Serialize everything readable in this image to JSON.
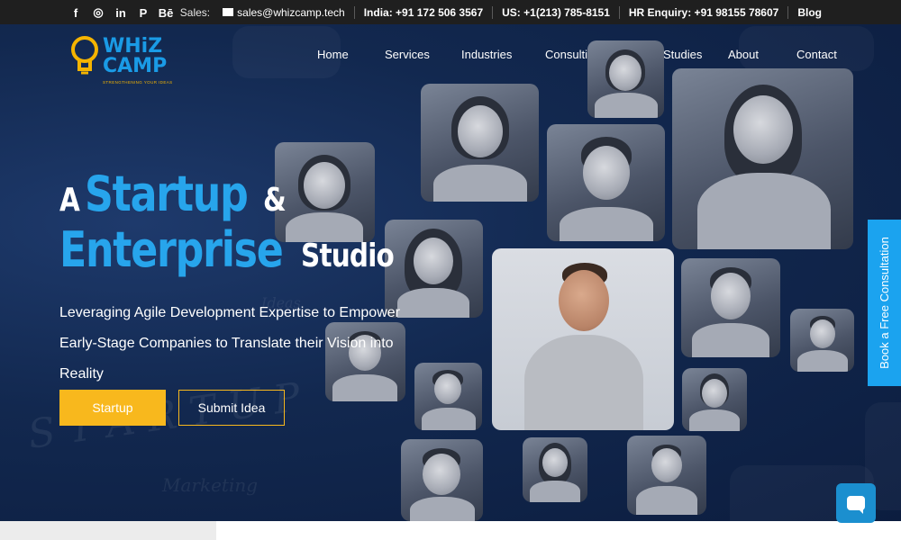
{
  "topbar": {
    "social_icons": [
      {
        "name": "facebook-icon",
        "glyph": "f"
      },
      {
        "name": "instagram-icon",
        "glyph": "◎"
      },
      {
        "name": "linkedin-icon",
        "glyph": "in"
      },
      {
        "name": "pinterest-icon",
        "glyph": "P"
      },
      {
        "name": "behance-icon",
        "glyph": "Bē"
      }
    ],
    "sales_label": "Sales:",
    "sales_email": "sales@whizcamp.tech",
    "india_phone": "India: +91 172 506 3567",
    "us_phone": "US: +1(213) 785-8151",
    "hr_enquiry": "HR Enquiry: +91 98155 78607",
    "blog": "Blog"
  },
  "logo": {
    "name": "WHiZ CAMP",
    "tagline": "STRENGTHENING YOUR IDEAS"
  },
  "nav": {
    "home": "Home",
    "services": "Services",
    "industries": "Industries",
    "consulting": "Consulting",
    "case_studies": "Case Studies",
    "about": "About",
    "contact": "Contact"
  },
  "hero": {
    "line1_a": "A",
    "line1_b": "Startup",
    "line1_c": "&",
    "line2_a": "Enterprise",
    "line2_b": "Studio",
    "subtitle": "Leveraging Agile Development Expertise to Empower Early-Stage Companies to Translate their Vision into Reality",
    "btn_startup": "Startup",
    "btn_idea": "Submit Idea"
  },
  "side_tab": "Book a Free Consultation",
  "colors": {
    "accent_blue": "#27a5ec",
    "accent_yellow": "#f8b81d",
    "hero_bg": "#12284f",
    "topbar_bg": "#1f1f1f"
  }
}
